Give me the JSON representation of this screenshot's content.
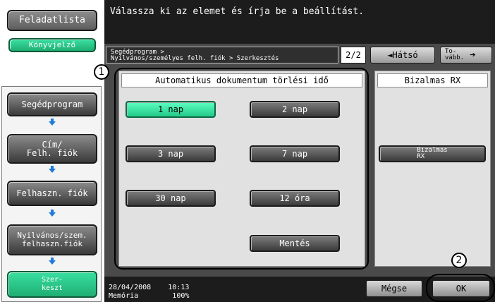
{
  "instruction": "Válassza ki az elemet és írja be a beállítást.",
  "sidebar": {
    "job_list": "Feladatlista",
    "bookmark": "Könyvjelző",
    "nav_items": [
      {
        "label": "Segédprogram"
      },
      {
        "label": "Cím/\nFelh. fiók"
      },
      {
        "label": "Felhaszn. fiók"
      },
      {
        "label": "Nyilvános/szem.\nfelhaszn.fiók"
      },
      {
        "label": "Szer-\nkeszt"
      }
    ]
  },
  "header": {
    "breadcrumb": "Segédprogram >\nNyilvános/személyes felh. fiók > Szerkesztés",
    "page": "2/2",
    "back_label": "◄Hátsó",
    "forward_label": "To-\nvább.",
    "forward_arrow": "➔"
  },
  "auto_delete": {
    "title": "Automatikus dokumentum törlési idő",
    "options": [
      "1 nap",
      "2 nap",
      "3 nap",
      "7 nap",
      "30 nap",
      "12 óra"
    ],
    "selected": "1 nap",
    "save_label": "Mentés"
  },
  "confidential": {
    "title": "Bizalmas RX",
    "button_label": "Bizalmas\nRX"
  },
  "callouts": {
    "one": "1",
    "two": "2"
  },
  "status": {
    "datetime": "28/04/2008    10:13",
    "memory": "Memória        100%"
  },
  "footer": {
    "cancel_label": "Mégse",
    "ok_label": "OK"
  },
  "colors": {
    "accent_green": "#23c989",
    "arrow_blue": "#1e7bd8",
    "dark_bar": "#1c1c1c"
  }
}
